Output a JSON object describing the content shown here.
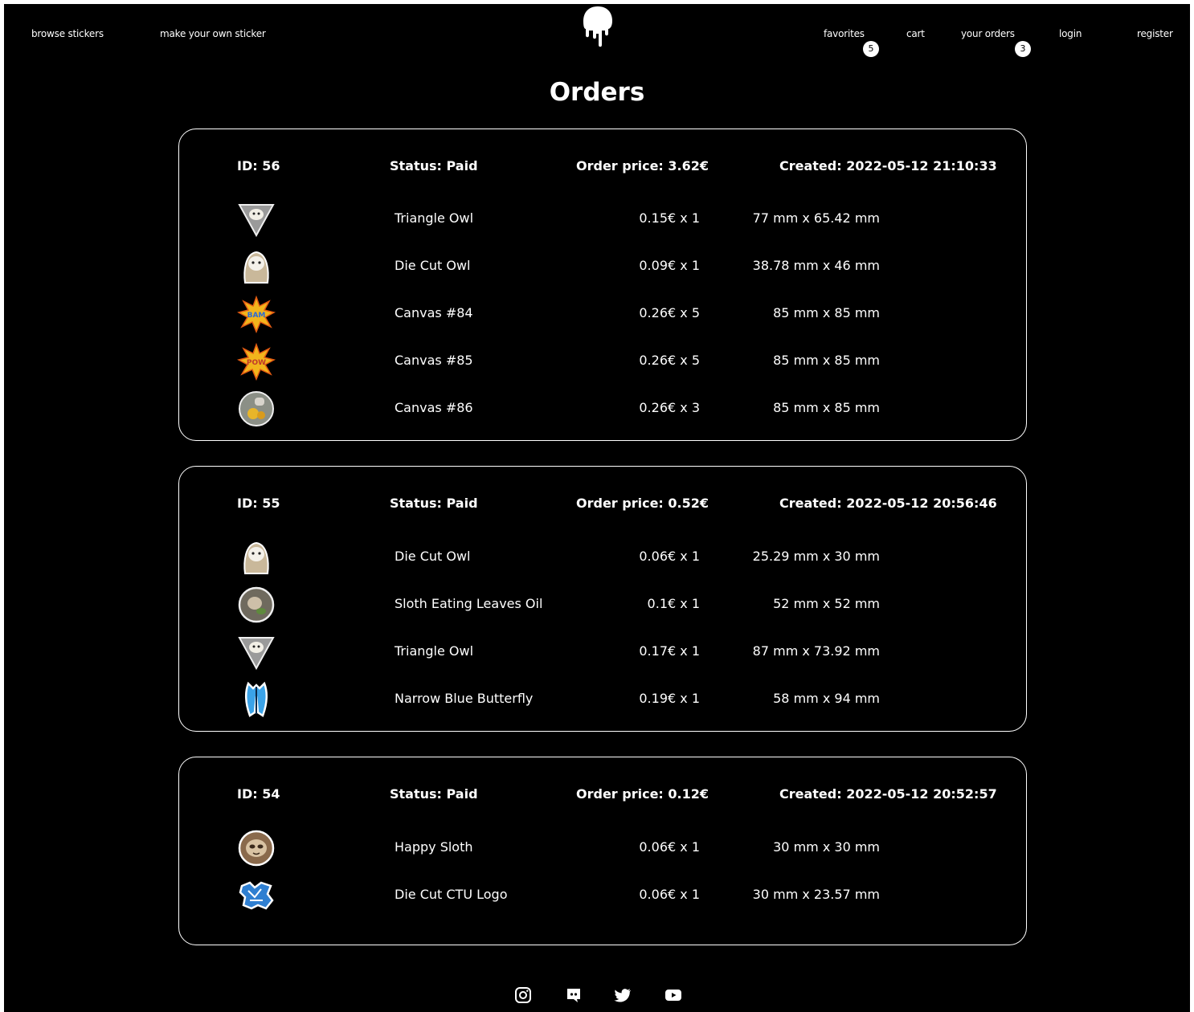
{
  "nav": {
    "browse": "browse stickers",
    "make": "make your own sticker",
    "favorites": "favorites",
    "favorites_count": "5",
    "cart": "cart",
    "orders": "your orders",
    "orders_count": "3",
    "login": "login",
    "register": "register"
  },
  "page_title": "Orders",
  "orders": [
    {
      "id": "ID: 56",
      "status": "Status: Paid",
      "price": "Order price: 3.62€",
      "created": "Created: 2022-05-12 21:10:33",
      "items": [
        {
          "thumb": "triangle-owl",
          "name": "Triangle Owl",
          "price": "0.15€ x 1",
          "size": "77 mm x 65.42 mm"
        },
        {
          "thumb": "die-cut-owl",
          "name": "Die Cut Owl",
          "price": "0.09€ x 1",
          "size": "38.78 mm x 46 mm"
        },
        {
          "thumb": "canvas-burst",
          "name": "Canvas #84",
          "price": "0.26€ x 5",
          "size": "85 mm x 85 mm"
        },
        {
          "thumb": "canvas-burst",
          "name": "Canvas #85",
          "price": "0.26€ x 5",
          "size": "85 mm x 85 mm"
        },
        {
          "thumb": "canvas-circle",
          "name": "Canvas #86",
          "price": "0.26€ x 3",
          "size": "85 mm x 85 mm"
        }
      ]
    },
    {
      "id": "ID: 55",
      "status": "Status: Paid",
      "price": "Order price: 0.52€",
      "created": "Created: 2022-05-12 20:56:46",
      "items": [
        {
          "thumb": "die-cut-owl",
          "name": "Die Cut Owl",
          "price": "0.06€ x 1",
          "size": "25.29 mm x 30 mm"
        },
        {
          "thumb": "sloth-circle",
          "name": "Sloth Eating Leaves Oil",
          "price": "0.1€ x 1",
          "size": "52 mm x 52 mm"
        },
        {
          "thumb": "triangle-owl",
          "name": "Triangle Owl",
          "price": "0.17€ x 1",
          "size": "87 mm x 73.92 mm"
        },
        {
          "thumb": "butterfly",
          "name": "Narrow Blue Butterfly",
          "price": "0.19€ x 1",
          "size": "58 mm x 94 mm"
        }
      ]
    },
    {
      "id": "ID: 54",
      "status": "Status: Paid",
      "price": "Order price: 0.12€",
      "created": "Created: 2022-05-12 20:52:57",
      "items": [
        {
          "thumb": "happy-sloth",
          "name": "Happy Sloth",
          "price": "0.06€ x 1",
          "size": "30 mm x 30 mm"
        },
        {
          "thumb": "ctu-logo",
          "name": "Die Cut CTU Logo",
          "price": "0.06€ x 1",
          "size": "30 mm x 23.57 mm"
        }
      ]
    }
  ],
  "footer_icons": [
    "instagram-icon",
    "discord-icon",
    "twitter-icon",
    "youtube-icon"
  ]
}
